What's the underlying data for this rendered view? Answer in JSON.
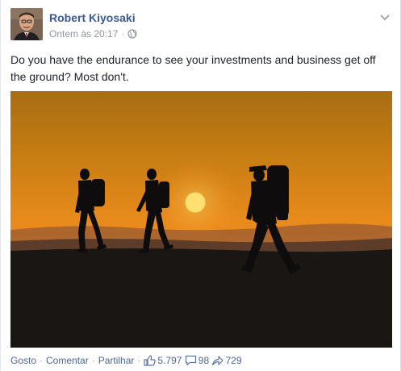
{
  "post": {
    "author": "Robert Kiyosaki",
    "timestamp": "Ontem às 20:17",
    "separator": "·",
    "privacy_icon": "globe-icon",
    "menu_icon": "chevron-down-icon",
    "message": "Do you have the endurance to see your investments and business get off the ground? Most don't.",
    "photo": {
      "subject": "silhouettes of three hikers walking at sunset",
      "sky_top": "#a86d14",
      "sky_horizon": "#f08a1c",
      "sun_color": "#ffe070"
    }
  },
  "actions": {
    "like": "Gosto",
    "comment": "Comentar",
    "share": "Partilhar",
    "dot": "·",
    "likes_count": "5.797",
    "comments_count": "98",
    "shares_count": "729"
  },
  "colors": {
    "link": "#3b5998",
    "meta": "#90949c",
    "text": "#1d2129"
  }
}
